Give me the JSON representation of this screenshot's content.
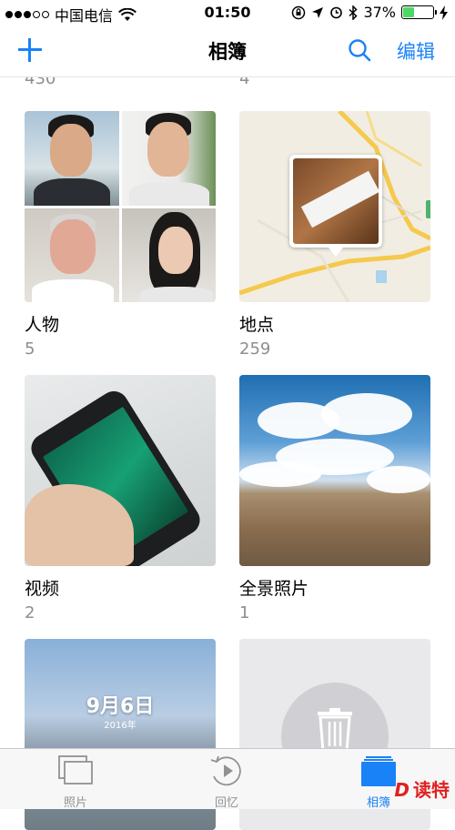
{
  "status_bar": {
    "carrier": "中国电信",
    "signal_dots_filled": 3,
    "signal_dots_total": 5,
    "time": "01:50",
    "battery_percent": "37%",
    "battery_level": 0.37
  },
  "nav": {
    "title": "相簿",
    "edit_label": "编辑"
  },
  "partial_counts": [
    "430",
    "4"
  ],
  "albums": [
    {
      "label": "人物",
      "count": "5"
    },
    {
      "label": "地点",
      "count": "259"
    },
    {
      "label": "视频",
      "count": "2"
    },
    {
      "label": "全景照片",
      "count": "1"
    }
  ],
  "memory_tile": {
    "date": "9月6日",
    "year": "2016年"
  },
  "tabs": [
    {
      "label": "照片",
      "active": false
    },
    {
      "label": "回忆",
      "active": false
    },
    {
      "label": "相簿",
      "active": true
    }
  ],
  "watermark": "读特",
  "colors": {
    "accent": "#1a82f7",
    "battery": "#4cd964",
    "secondary_text": "#8e8e93"
  }
}
